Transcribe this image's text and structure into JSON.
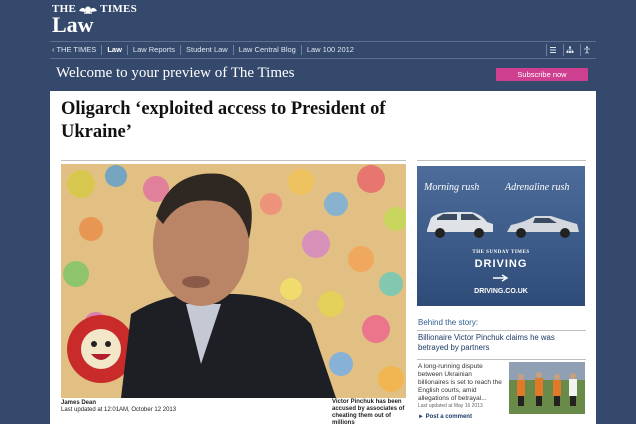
{
  "masthead": {
    "brand_top_left": "THE",
    "brand_top_right": "TIMES",
    "brand_main": "Law"
  },
  "nav": {
    "items": [
      {
        "label": "‹ THE TIMES",
        "active": false
      },
      {
        "label": "Law",
        "active": true
      },
      {
        "label": "Law Reports",
        "active": false
      },
      {
        "label": "Student Law",
        "active": false
      },
      {
        "label": "Law Central Blog",
        "active": false
      },
      {
        "label": "Law 100 2012",
        "active": false
      }
    ],
    "icons": [
      "list-view-icon",
      "sitemap-icon",
      "accessibility-icon"
    ]
  },
  "preview": {
    "welcome": "Welcome to your preview of The Times",
    "subscribe_label": "Subscribe now"
  },
  "article": {
    "headline": "Oligarch ‘exploited access to President of Ukraine’",
    "author": "James Dean",
    "updated": "Last updated at 12:01AM, October 12 2013",
    "caption": "Victor Pinchuk has been accused by associates of cheating them out of millions"
  },
  "ad": {
    "left_heading": "Morning rush",
    "right_heading": "Adrenaline rush",
    "publication": "THE SUNDAY TIMES",
    "section": "DRIVING",
    "url": "DRIVING.CO.UK"
  },
  "behind_story": {
    "label": "Behind the story:",
    "title": "Billionaire Victor Pinchuk claims he was betrayed by partners",
    "summary": "A long-running dispute between Ukrainian billionaires is set to reach the English courts, amid allegations of betrayal...",
    "updated": "Last updated at May 16 2013",
    "comment": "Post a comment"
  },
  "colors": {
    "background": "#34496b",
    "panel": "#ffffff",
    "subscribe": "#cf3f8f",
    "link": "#1d3a67"
  }
}
